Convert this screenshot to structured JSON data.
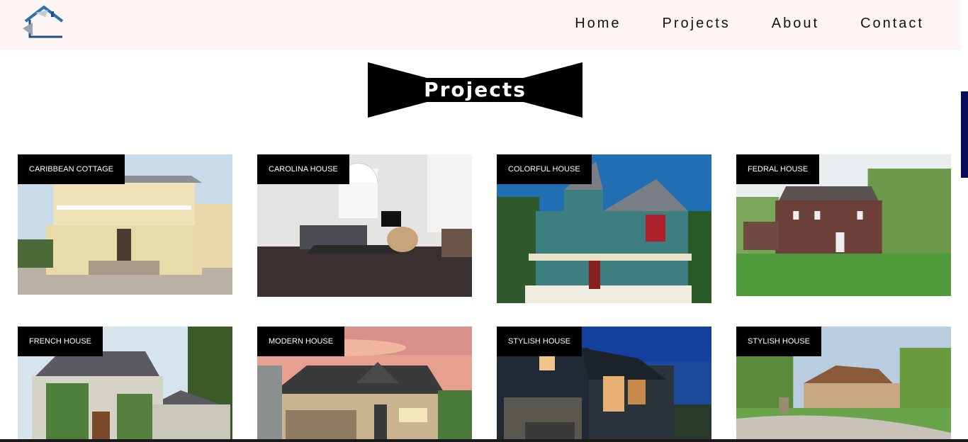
{
  "header": {
    "nav": [
      "Home",
      "Projects",
      "About",
      "Contact"
    ]
  },
  "page_title": "Projects",
  "projects": [
    {
      "label": "CARIBBEAN COTTAGE",
      "icon": "house-photo"
    },
    {
      "label": "CAROLINA HOUSE",
      "icon": "interior-photo"
    },
    {
      "label": "COLORFUL HOUSE",
      "icon": "house-photo"
    },
    {
      "label": "FEDRAL HOUSE",
      "icon": "house-photo"
    },
    {
      "label": "FRENCH HOUSE",
      "icon": "house-photo"
    },
    {
      "label": "MODERN HOUSE",
      "icon": "house-photo"
    },
    {
      "label": "STYLISH HOUSE",
      "icon": "house-photo"
    },
    {
      "label": "STYLISH HOUSE",
      "icon": "house-photo"
    }
  ],
  "colors": {
    "header_bg": "#fcf5f3",
    "label_bg": "#000000",
    "accent": "#0a0a5a"
  }
}
